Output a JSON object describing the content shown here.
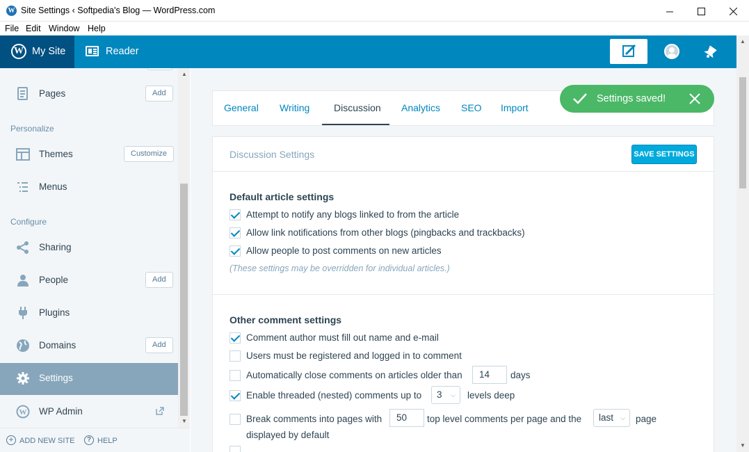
{
  "window": {
    "title": "Site Settings ‹ Softpedia's Blog — WordPress.com",
    "menu": [
      "File",
      "Edit",
      "Window",
      "Help"
    ]
  },
  "masterbar": {
    "mysite_label": "My Site",
    "reader_label": "Reader",
    "accent": "#0087be",
    "mysite_bg": "#005082"
  },
  "sidebar": {
    "items": [
      {
        "label": "Pages",
        "button": "Add",
        "icon": "pages-icon"
      },
      {
        "label": "Themes",
        "button": "Customize",
        "icon": "themes-icon"
      },
      {
        "label": "Menus",
        "icon": "menus-icon"
      },
      {
        "label": "Sharing",
        "icon": "share-icon"
      },
      {
        "label": "People",
        "button": "Add",
        "icon": "person-icon"
      },
      {
        "label": "Plugins",
        "icon": "plug-icon"
      },
      {
        "label": "Domains",
        "button": "Add",
        "icon": "globe-icon"
      },
      {
        "label": "Settings",
        "icon": "cog-icon",
        "active": true
      },
      {
        "label": "WP Admin",
        "icon": "wordpress-icon"
      }
    ],
    "headings": {
      "personalize": "Personalize",
      "configure": "Configure"
    },
    "footer": {
      "add_site": "ADD NEW SITE",
      "help": "HELP"
    },
    "active_color": "#87a6bc"
  },
  "tabs": [
    "General",
    "Writing",
    "Discussion",
    "Analytics",
    "SEO",
    "Import"
  ],
  "active_tab": "Discussion",
  "notice": {
    "text": "Settings saved!",
    "color": "#4ab866"
  },
  "card": {
    "title": "Discussion Settings",
    "save_label": "SAVE SETTINGS",
    "default_section": {
      "title": "Default article settings",
      "options": [
        {
          "label": "Attempt to notify any blogs linked to from the article",
          "checked": true
        },
        {
          "label": "Allow link notifications from other blogs (pingbacks and trackbacks)",
          "checked": true
        },
        {
          "label": "Allow people to post comments on new articles",
          "checked": true
        }
      ],
      "note": "(These settings may be overridden for individual articles.)"
    },
    "other_section": {
      "title": "Other comment settings",
      "opt1": "Comment author must fill out name and e-mail",
      "opt2": "Users must be registered and logged in to comment",
      "opt3_pre": "Automatically close comments on articles older than",
      "opt3_value": "14",
      "opt3_post": "days",
      "opt4_pre": "Enable threaded (nested) comments up to",
      "opt4_value": "3",
      "opt4_post": "levels deep",
      "opt5_pre": "Break comments into pages with",
      "opt5_value": "50",
      "opt5_mid": "top level comments per page and the",
      "opt5_select": "last",
      "opt5_post": "page",
      "opt5_line2": "displayed by default",
      "checked": [
        true,
        false,
        false,
        true,
        false
      ]
    }
  }
}
